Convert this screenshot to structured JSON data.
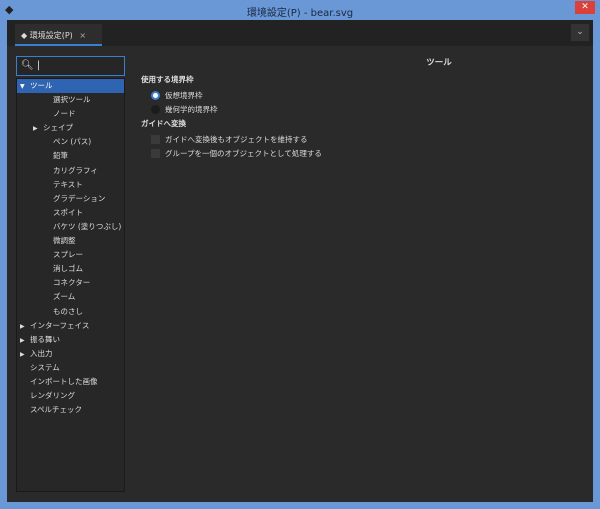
{
  "window": {
    "title": "環境設定(P) - bear.svg",
    "close": "✕"
  },
  "tab": {
    "label": "環境設定(P)",
    "close": "×",
    "chevron": "⌄"
  },
  "search": {
    "value": "|"
  },
  "tree": [
    {
      "label": "ツール",
      "level": 0,
      "arrow": "▼",
      "selected": true
    },
    {
      "label": "選択ツール",
      "level": 2
    },
    {
      "label": "ノード",
      "level": 2
    },
    {
      "label": "シェイプ",
      "level": 1,
      "arrow": "▶"
    },
    {
      "label": "ペン (パス)",
      "level": 2
    },
    {
      "label": "鉛筆",
      "level": 2
    },
    {
      "label": "カリグラフィ",
      "level": 2
    },
    {
      "label": "テキスト",
      "level": 2
    },
    {
      "label": "グラデーション",
      "level": 2
    },
    {
      "label": "スポイト",
      "level": 2
    },
    {
      "label": "バケツ (塗りつぶし)",
      "level": 2
    },
    {
      "label": "微調整",
      "level": 2
    },
    {
      "label": "スプレー",
      "level": 2
    },
    {
      "label": "消しゴム",
      "level": 2
    },
    {
      "label": "コネクター",
      "level": 2
    },
    {
      "label": "ズーム",
      "level": 2
    },
    {
      "label": "ものさし",
      "level": 2
    },
    {
      "label": "インターフェイス",
      "level": 0,
      "arrow": "▶"
    },
    {
      "label": "振る舞い",
      "level": 0,
      "arrow": "▶"
    },
    {
      "label": "入出力",
      "level": 0,
      "arrow": "▶"
    },
    {
      "label": "システム",
      "level": 0
    },
    {
      "label": "インポートした画像",
      "level": 0
    },
    {
      "label": "レンダリング",
      "level": 0
    },
    {
      "label": "スペルチェック",
      "level": 0
    }
  ],
  "main": {
    "heading": "ツール",
    "bbox_section": "使用する境界枠",
    "radios": [
      {
        "label": "仮想境界枠",
        "checked": true
      },
      {
        "label": "幾何学的境界枠",
        "checked": false
      }
    ],
    "guide_section": "ガイドへ変換",
    "checks": [
      {
        "label": "ガイドへ変換後もオブジェクトを維持する",
        "checked": false
      },
      {
        "label": "グループを一個のオブジェクトとして処理する",
        "checked": false
      }
    ]
  },
  "colors": {
    "accent": "#3b7fd0",
    "frame": "#6a97d6",
    "close": "#d9413a"
  }
}
